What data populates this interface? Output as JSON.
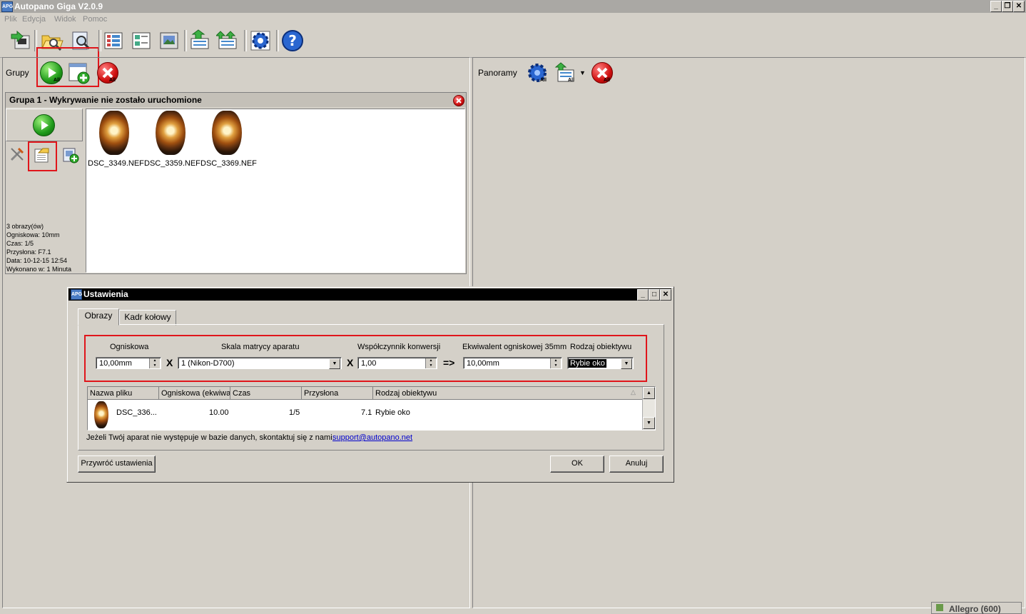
{
  "app": {
    "title": "Autopano Giga V2.0.9",
    "icon_text": "APG"
  },
  "window_buttons": {
    "minimize": "_",
    "restore": "❐",
    "close": "✕"
  },
  "menu": [
    "Plik",
    "Edycja",
    "Widok",
    "Pomoc"
  ],
  "toolbar": {
    "icons": [
      "import-icon",
      "open-folder-icon",
      "search-images-icon",
      "grid-view-icon",
      "detail-view-icon",
      "preview-view-icon",
      "export-icon",
      "batch-export-icon",
      "settings-gear-icon",
      "help-icon"
    ]
  },
  "groups_panel": {
    "label": "Grupy",
    "badge": "All"
  },
  "panoramas_panel": {
    "label": "Panoramy",
    "badge": "All"
  },
  "group": {
    "header": "Grupa 1 - Wykrywanie nie zostało uruchomione",
    "images": [
      {
        "name": "DSC_3349.NEF"
      },
      {
        "name": "DSC_3359.NEF"
      },
      {
        "name": "DSC_3369.NEF"
      }
    ],
    "info": {
      "count": "3 obrazy(ów)",
      "focal": "Ogniskowa: 10mm",
      "time": "Czas: 1/5",
      "aperture": "Przysłona: F7.1",
      "date": "Data: 10-12-15 12:54",
      "done": "Wykonano w: 1 Minuta"
    }
  },
  "dialog": {
    "title": "Ustawienia",
    "tabs": [
      "Obrazy",
      "Kadr kołowy"
    ],
    "fields": {
      "focal_label": "Ogniskowa",
      "focal_value": "10,00mm",
      "sensor_label": "Skala matrycy aparatu",
      "sensor_value": "1 (Nikon-D700)",
      "conversion_label": "Współczynnik konwersji",
      "conversion_value": "1,00",
      "equivalent_label": "Ekwiwalent ogniskowej 35mm",
      "equivalent_value": "10,00mm",
      "lens_label": "Rodzaj obiektywu",
      "lens_value": "Rybie oko",
      "op_times": "X",
      "op_result": "=>"
    },
    "table": {
      "columns": [
        "Nazwa pliku",
        "Ogniskowa (ekwiwa",
        "Czas",
        "Przysłona",
        "Rodzaj obiektywu"
      ],
      "rows": [
        {
          "file": "DSC_336...",
          "focal": "10.00",
          "time": "1/5",
          "aperture": "7.1",
          "lens": "Rybie oko"
        }
      ]
    },
    "contact_text": "Jeżeli Twój aparat nie występuje w bazie danych, skontaktuj się z nami.",
    "contact_link": "support@autopano.net",
    "restore_button": "Przywróć ustawienia",
    "ok_button": "OK",
    "cancel_button": "Anuluj"
  },
  "status": {
    "text": "Allegro (600)"
  },
  "colors": {
    "highlight": "#e0151b",
    "face": "#d4d0c8",
    "link": "#0000cc"
  }
}
